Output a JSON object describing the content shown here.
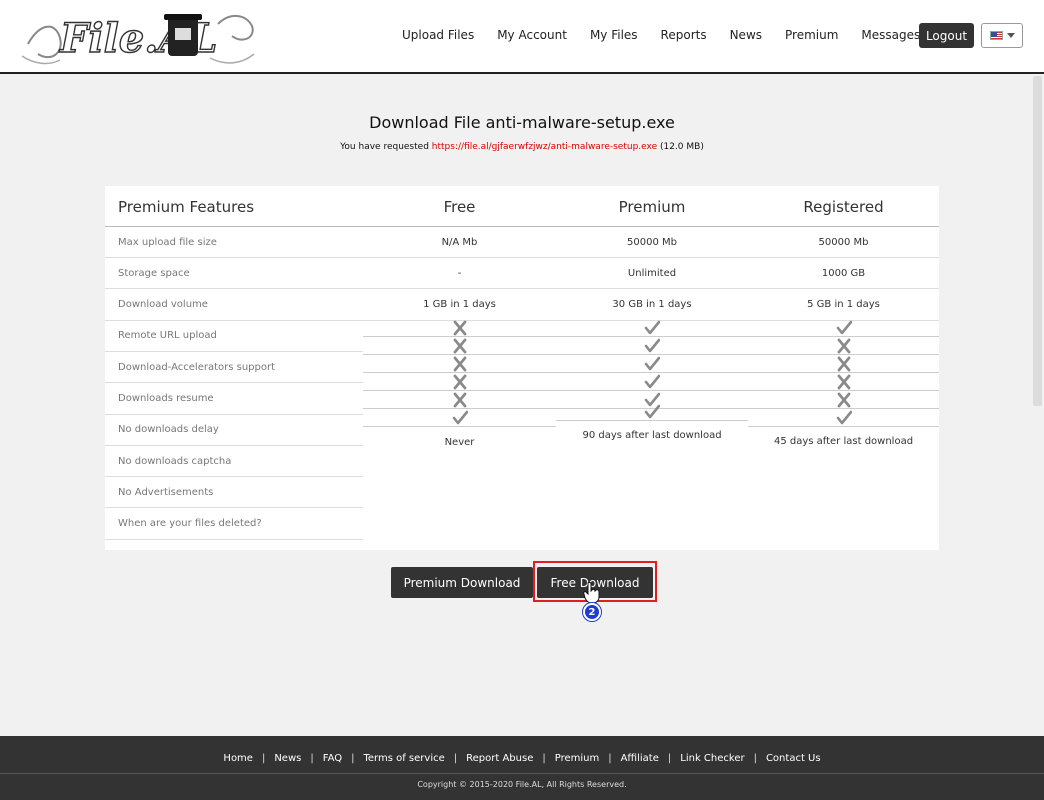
{
  "header": {
    "logo_alt": "File.AL",
    "nav": [
      "Upload Files",
      "My Account",
      "My Files",
      "Reports",
      "News",
      "Premium",
      "Messages (0)"
    ],
    "logout_label": "Logout"
  },
  "download": {
    "title": "Download File anti-malware-setup.exe",
    "requested_prefix": "You have requested",
    "link": "https://file.al/gjfaerwfzjwz/anti-malware-setup.exe",
    "size": "(12.0 MB)"
  },
  "features": {
    "headers": [
      "Premium Features",
      "Free",
      "Premium",
      "Registered"
    ],
    "rows": [
      {
        "label": "Max upload file size",
        "free": "N/A Mb",
        "premium": "50000 Mb",
        "registered": "50000 Mb"
      },
      {
        "label": "Storage space",
        "free": "-",
        "premium": "Unlimited",
        "registered": "1000 GB"
      },
      {
        "label": "Download volume",
        "free": "1 GB in 1 days",
        "premium": "30 GB in 1 days",
        "registered": "5 GB in 1 days"
      },
      {
        "label": "Remote URL upload"
      },
      {
        "label": "Download-Accelerators support"
      },
      {
        "label": "Downloads resume"
      },
      {
        "label": "No downloads delay"
      },
      {
        "label": "No downloads captcha"
      },
      {
        "label": "No Advertisements"
      },
      {
        "label": "When are your files deleted?"
      }
    ],
    "icons": {
      "free": [
        "cross",
        "cross",
        "cross",
        "cross",
        "cross",
        "check"
      ],
      "premium": [
        "check",
        "check",
        "check",
        "check",
        "check",
        "check"
      ],
      "registered": [
        "check",
        "cross",
        "cross",
        "cross",
        "cross",
        "check"
      ]
    },
    "deleted": {
      "free": "Never",
      "premium": "90 days after last download",
      "registered": "45 days after last download"
    }
  },
  "buttons": {
    "premium": "Premium Download",
    "free": "Free Download"
  },
  "step_badge": "2",
  "footer": {
    "links": [
      "Home",
      "News",
      "FAQ",
      "Terms of service",
      "Report Abuse",
      "Premium",
      "Affiliate",
      "Link Checker",
      "Contact Us"
    ],
    "copyright": "Copyright © 2015-2020 File.AL, All Rights Reserved."
  },
  "colors": {
    "accent_link": "#dd0000",
    "button_dark": "#333333",
    "highlight": "#e21d1d",
    "badge": "#1f3bd1"
  }
}
